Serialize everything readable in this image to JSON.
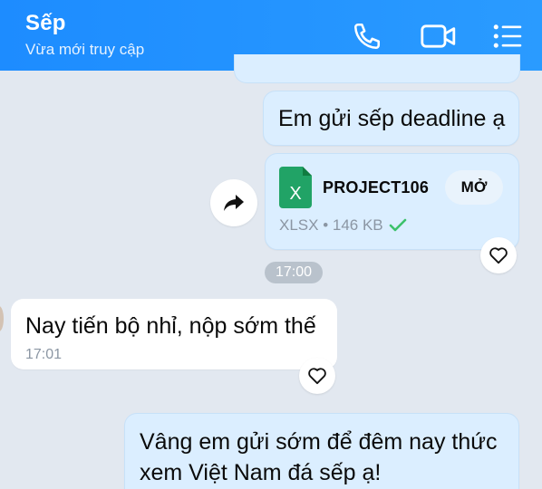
{
  "header": {
    "contact_name": "Sếp",
    "status": "Vừa mới truy cập",
    "icons": [
      "phone-icon",
      "video-call-icon",
      "menu-icon"
    ]
  },
  "messages": {
    "m1": {
      "text": "Em gửi sếp deadline ạ"
    },
    "file": {
      "name": "PROJECT106",
      "open_label": "MỞ",
      "meta": "XLSX • 146 KB",
      "icon_letter": "X"
    },
    "time_separator": "17:00",
    "m2": {
      "text": "Nay tiến bộ nhỉ, nộp sớm thế",
      "time": "17:01"
    },
    "m3": {
      "line1": "Vâng em gửi sớm để đêm nay thức",
      "line2": "xem Việt Nam đá sếp ạ!"
    }
  },
  "colors": {
    "header": "#1d8cff",
    "my_bubble": "#dbeeff",
    "their_bubble": "#ffffff",
    "background": "#e2e8f0",
    "excel_green": "#21a366",
    "check_green": "#3cc16b"
  }
}
